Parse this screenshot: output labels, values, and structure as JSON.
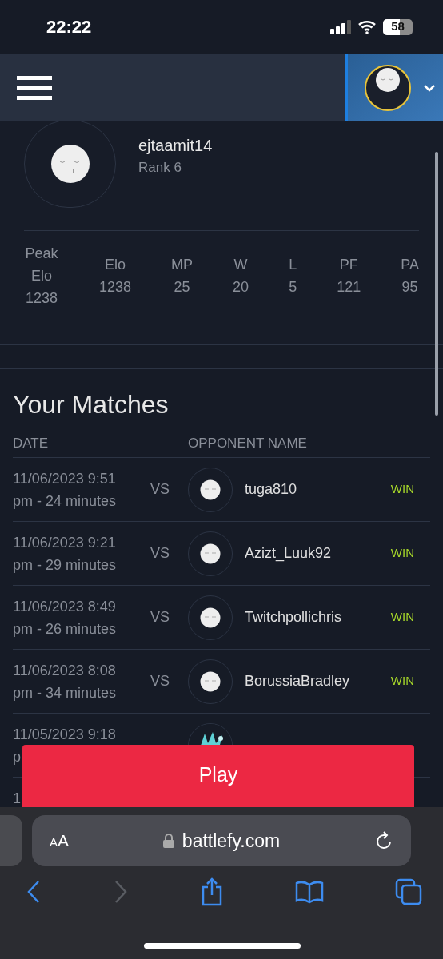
{
  "status_bar": {
    "time": "22:22",
    "battery": "58"
  },
  "profile": {
    "username": "ejtaamit14",
    "rank": "Rank 6",
    "stats": [
      {
        "label": "Peak Elo",
        "value": "1238"
      },
      {
        "label": "Elo",
        "value": "1238"
      },
      {
        "label": "MP",
        "value": "25"
      },
      {
        "label": "W",
        "value": "20"
      },
      {
        "label": "L",
        "value": "5"
      },
      {
        "label": "PF",
        "value": "121"
      },
      {
        "label": "PA",
        "value": "95"
      }
    ]
  },
  "matches": {
    "title": "Your Matches",
    "columns": [
      "DATE",
      "OPPONENT NAME"
    ],
    "rows": [
      {
        "kind": "full",
        "date": "11/06/2023 9:51",
        "duration": "pm - 24 minutes",
        "vs": "VS",
        "opponent": "tuga810",
        "result": "WIN"
      },
      {
        "kind": "full",
        "date": "11/06/2023 9:21",
        "duration": "pm - 29 minutes",
        "vs": "VS",
        "opponent": "Azizt_Luuk92",
        "result": "WIN"
      },
      {
        "kind": "full",
        "date": "11/06/2023 8:49",
        "duration": "pm - 26 minutes",
        "vs": "VS",
        "opponent": "Twitchpollichris",
        "result": "WIN"
      },
      {
        "kind": "full",
        "date": "11/06/2023 8:08",
        "duration": "pm - 34 minutes",
        "vs": "VS",
        "opponent": "BorussiaBradley",
        "result": "WIN"
      },
      {
        "kind": "covered",
        "date": "11/05/2023 9:18",
        "duration": "p"
      },
      {
        "kind": "covered",
        "date": "1"
      }
    ]
  },
  "play_button": "Play",
  "browser": {
    "text_size": "AA",
    "url": "battlefy.com"
  }
}
